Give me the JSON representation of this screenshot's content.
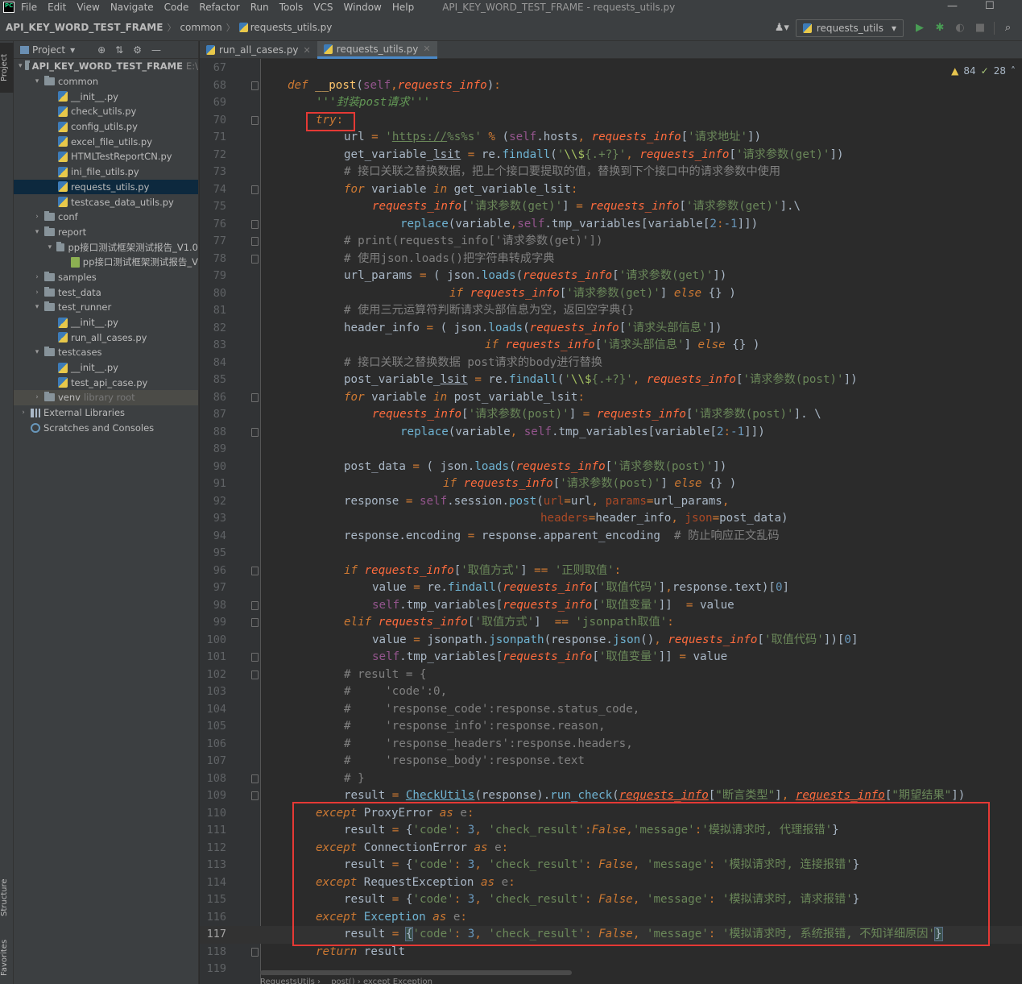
{
  "menubar": {
    "items": [
      "File",
      "Edit",
      "View",
      "Navigate",
      "Code",
      "Refactor",
      "Run",
      "Tools",
      "VCS",
      "Window",
      "Help"
    ],
    "window_title": "API_KEY_WORD_TEST_FRAME - requests_utils.py",
    "minimize": "—",
    "maximize": "☐"
  },
  "navbar": {
    "project": "API_KEY_WORD_TEST_FRAME",
    "folder": "common",
    "file": "requests_utils.py",
    "run_config": "requests_utils",
    "run_config_arrow": "▾"
  },
  "toolstrip": {
    "project_tab": "Project",
    "structure_tab": "Structure",
    "favorites_tab": "Favorites"
  },
  "project_panel": {
    "title": "Project",
    "tree": [
      {
        "label": "API_KEY_WORD_TEST_FRAME",
        "suffix": "E:\\",
        "type": "folder",
        "depth": 0,
        "arrow": "▾",
        "bold": true
      },
      {
        "label": "common",
        "type": "folder",
        "depth": 1,
        "arrow": "▾"
      },
      {
        "label": "__init__.py",
        "type": "py",
        "depth": 2
      },
      {
        "label": "check_utils.py",
        "type": "py",
        "depth": 2
      },
      {
        "label": "config_utils.py",
        "type": "py",
        "depth": 2
      },
      {
        "label": "excel_file_utils.py",
        "type": "py",
        "depth": 2
      },
      {
        "label": "HTMLTestReportCN.py",
        "type": "py",
        "depth": 2
      },
      {
        "label": "ini_file_utils.py",
        "type": "py",
        "depth": 2
      },
      {
        "label": "requests_utils.py",
        "type": "py",
        "depth": 2,
        "selected": true
      },
      {
        "label": "testcase_data_utils.py",
        "type": "py",
        "depth": 2
      },
      {
        "label": "conf",
        "type": "folder",
        "depth": 1,
        "arrow": "›"
      },
      {
        "label": "report",
        "type": "folder",
        "depth": 1,
        "arrow": "▾"
      },
      {
        "label": "pp接口测试框架测试报告_V1.0",
        "type": "folder",
        "depth": 2,
        "arrow": "▾"
      },
      {
        "label": "pp接口测试框架测试报告_V",
        "type": "html",
        "depth": 3
      },
      {
        "label": "samples",
        "type": "folder",
        "depth": 1,
        "arrow": "›"
      },
      {
        "label": "test_data",
        "type": "folder",
        "depth": 1,
        "arrow": "›"
      },
      {
        "label": "test_runner",
        "type": "folder",
        "depth": 1,
        "arrow": "▾"
      },
      {
        "label": "__init__.py",
        "type": "py",
        "depth": 2
      },
      {
        "label": "run_all_cases.py",
        "type": "py",
        "depth": 2
      },
      {
        "label": "testcases",
        "type": "folder",
        "depth": 1,
        "arrow": "▾"
      },
      {
        "label": "__init__.py",
        "type": "py",
        "depth": 2
      },
      {
        "label": "test_api_case.py",
        "type": "py",
        "depth": 2
      },
      {
        "label": "venv",
        "suffix": "library root",
        "type": "folder",
        "depth": 1,
        "arrow": "›",
        "venv": true
      },
      {
        "label": "External Libraries",
        "type": "lib",
        "depth": 0,
        "arrow": "›"
      },
      {
        "label": "Scratches and Consoles",
        "type": "scratch",
        "depth": 0,
        "arrow": ""
      }
    ]
  },
  "tabs": [
    {
      "label": "run_all_cases.py",
      "active": false
    },
    {
      "label": "requests_utils.py",
      "active": true
    }
  ],
  "inspections": {
    "warnings": "84",
    "weak_warnings": "28"
  },
  "editor": {
    "first_line": 67,
    "current_line": 117,
    "footer_hint": "RequestsUtils  ›  __post()  ›  except Exception"
  },
  "colors": {
    "background": "#2b2b2b",
    "keyword": "#cc7832",
    "string": "#6a8759",
    "comment": "#808080",
    "function": "#ffc66d",
    "self": "#94558d",
    "number": "#6897bb",
    "highlight_box": "#e53935",
    "selection": "#0d293e"
  },
  "icons": {
    "run": "play-icon",
    "debug": "bug-icon",
    "coverage": "coverage-icon",
    "stop": "stop-icon",
    "search": "search-icon",
    "user": "user-icon"
  }
}
